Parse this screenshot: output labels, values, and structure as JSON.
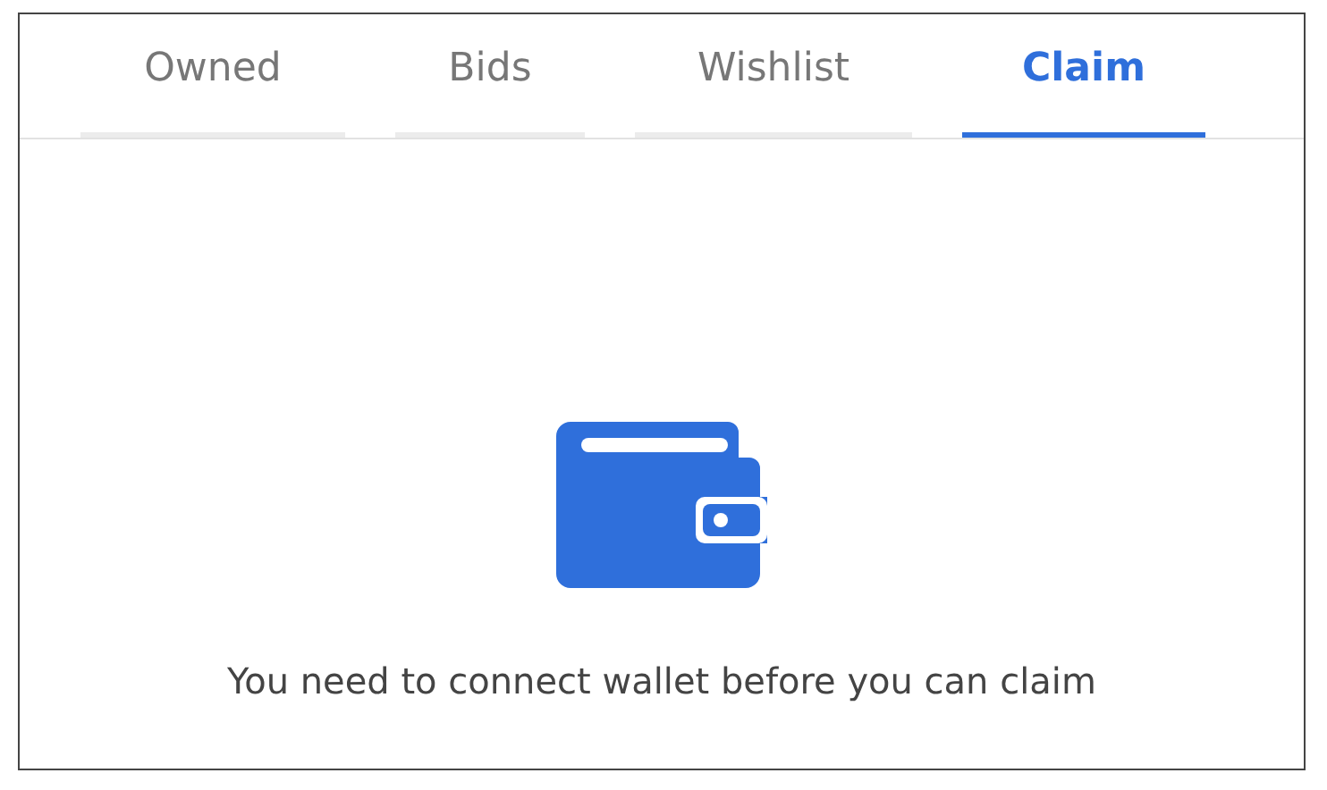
{
  "tabs": [
    {
      "label": "Owned",
      "selected": false
    },
    {
      "label": "Bids",
      "selected": false
    },
    {
      "label": "Wishlist",
      "selected": false
    },
    {
      "label": "Claim",
      "selected": true
    }
  ],
  "empty_state": {
    "message": "You need to connect wallet before you can claim"
  }
}
